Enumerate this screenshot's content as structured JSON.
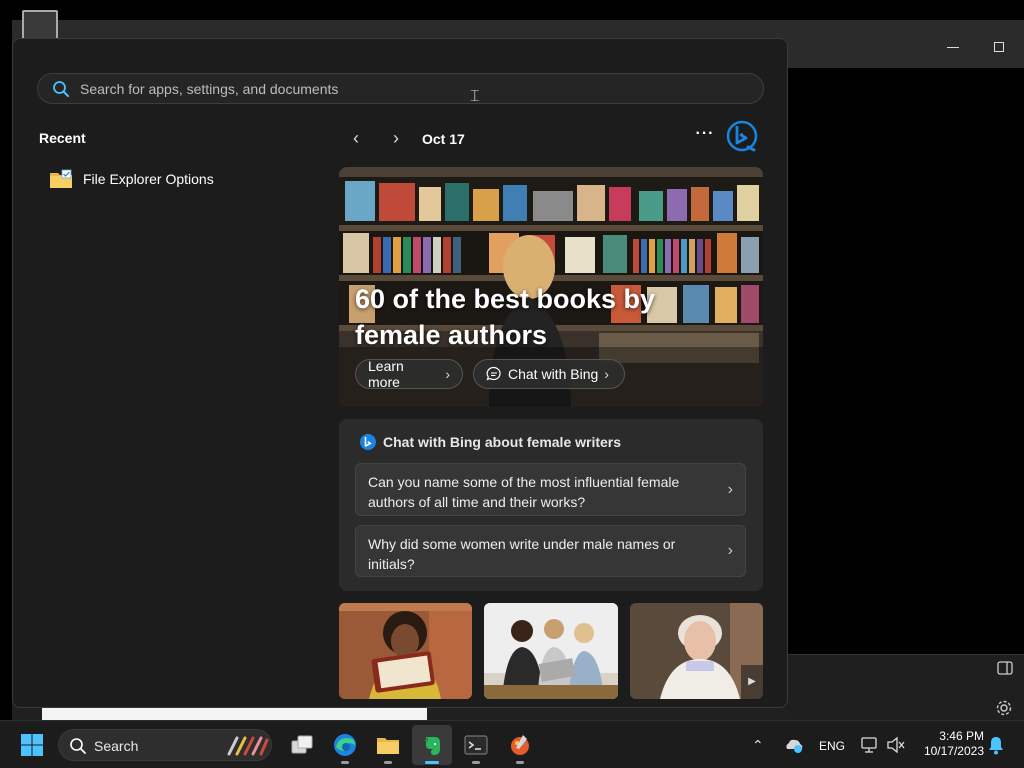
{
  "search": {
    "placeholder": "Search for apps, settings, and documents"
  },
  "recent": {
    "title": "Recent",
    "items": [
      {
        "label": "File Explorer Options",
        "icon": "folder-options-icon"
      }
    ]
  },
  "feed": {
    "date": "Oct 17",
    "hero": {
      "title": "60 of the best books by female authors",
      "learn_more": "Learn more",
      "chat_with_bing": "Chat with Bing"
    },
    "chat_card": {
      "heading": "Chat with Bing about female writers",
      "questions": [
        "Can you name some of the most influential female authors of all time and their works?",
        "Why did some women write under male names or initials?"
      ]
    }
  },
  "taskbar": {
    "search_label": "Search",
    "language": "ENG",
    "time": "3:46 PM",
    "date": "10/17/2023"
  },
  "colors": {
    "accent": "#4cc2ff",
    "bing_blue": "#1b84e0",
    "flyout_bg": "#1c1c1c",
    "card_bg": "#2b2b2b"
  }
}
